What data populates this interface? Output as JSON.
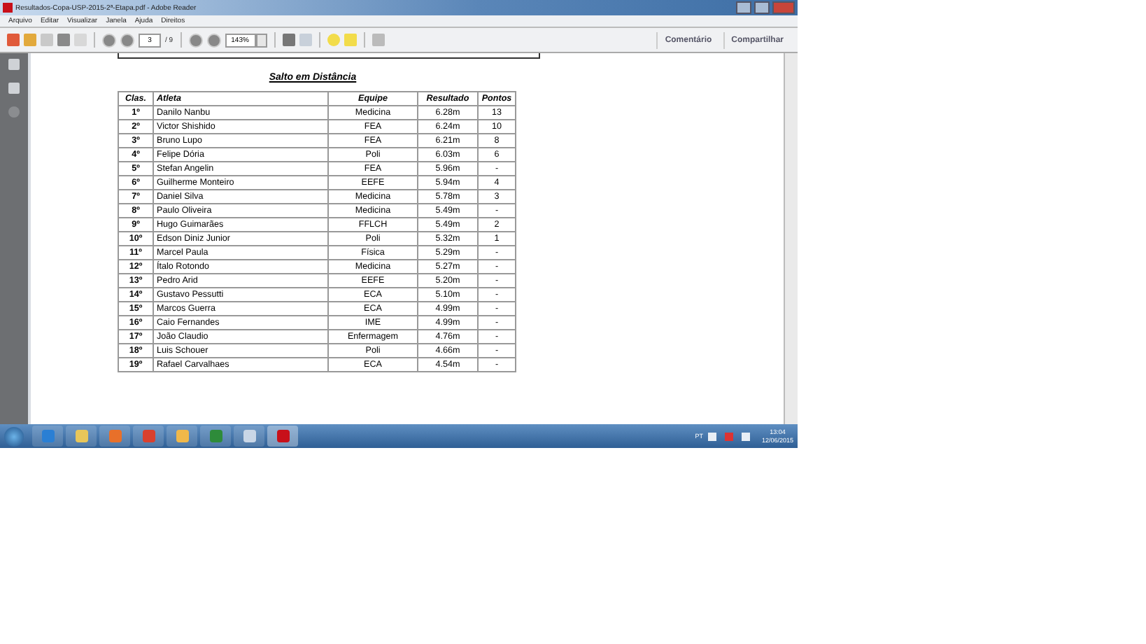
{
  "window": {
    "title": "Resultados-Copa-USP-2015-2ª-Etapa.pdf - Adobe Reader"
  },
  "menu": [
    "Arquivo",
    "Editar",
    "Visualizar",
    "Janela",
    "Ajuda",
    "Direitos"
  ],
  "toolbar": {
    "page_number": "3",
    "page_total": "/ 9",
    "zoom": "143%",
    "right_buttons": [
      "Comentário",
      "Compartilhar"
    ]
  },
  "document": {
    "heading": "Salto em Distância",
    "table": {
      "columns": [
        "Clas.",
        "Atleta",
        "Equipe",
        "Resultado",
        "Pontos"
      ],
      "rows": [
        [
          "1º",
          "Danilo Nanbu",
          "Medicina",
          "6.28m",
          "13"
        ],
        [
          "2º",
          "Victor Shishido",
          "FEA",
          "6.24m",
          "10"
        ],
        [
          "3º",
          "Bruno Lupo",
          "FEA",
          "6.21m",
          "8"
        ],
        [
          "4º",
          "Felipe Dória",
          "Poli",
          "6.03m",
          "6"
        ],
        [
          "5º",
          "Stefan Angelin",
          "FEA",
          "5.96m",
          "-"
        ],
        [
          "6º",
          "Guilherme Monteiro",
          "EEFE",
          "5.94m",
          "4"
        ],
        [
          "7º",
          "Daniel Silva",
          "Medicina",
          "5.78m",
          "3"
        ],
        [
          "8º",
          "Paulo Oliveira",
          "Medicina",
          "5.49m",
          "-"
        ],
        [
          "9º",
          "Hugo Guimarães",
          "FFLCH",
          "5.49m",
          "2"
        ],
        [
          "10º",
          "Edson Diniz Junior",
          "Poli",
          "5.32m",
          "1"
        ],
        [
          "11º",
          "Marcel Paula",
          "Física",
          "5.29m",
          "-"
        ],
        [
          "12º",
          "Ítalo Rotondo",
          "Medicina",
          "5.27m",
          "-"
        ],
        [
          "13º",
          "Pedro Arid",
          "EEFE",
          "5.20m",
          "-"
        ],
        [
          "14º",
          "Gustavo Pessutti",
          "ECA",
          "5.10m",
          "-"
        ],
        [
          "15º",
          "Marcos Guerra",
          "ECA",
          "4.99m",
          "-"
        ],
        [
          "16º",
          "Caio Fernandes",
          "IME",
          "4.99m",
          "-"
        ],
        [
          "17º",
          "João Claudio",
          "Enfermagem",
          "4.76m",
          "-"
        ],
        [
          "18º",
          "Luis Schouer",
          "Poli",
          "4.66m",
          "-"
        ],
        [
          "19º",
          "Rafael Carvalhaes",
          "ECA",
          "4.54m",
          "-"
        ]
      ]
    }
  },
  "taskbar": {
    "language": "PT",
    "time": "13:04",
    "date": "12/06/2015"
  }
}
